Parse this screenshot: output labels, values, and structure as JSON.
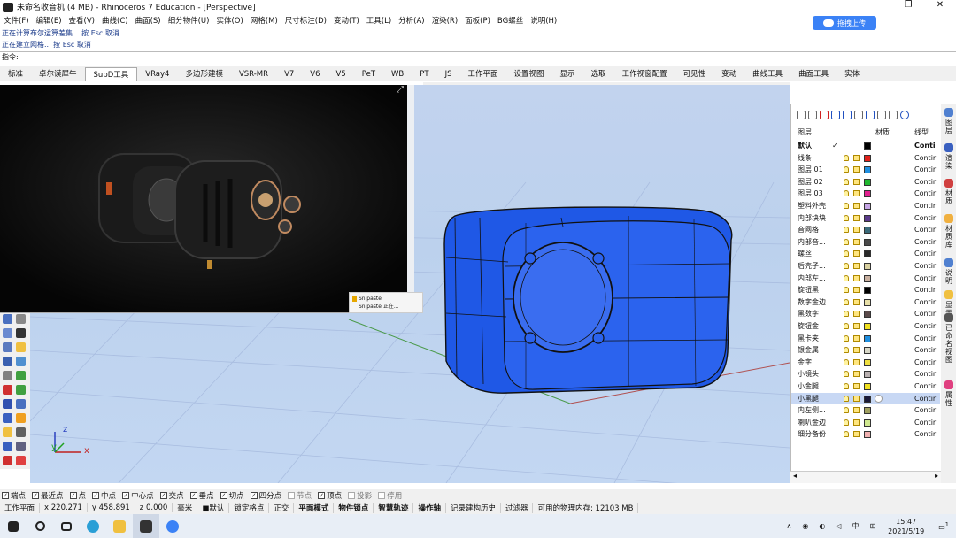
{
  "window": {
    "title": "未命名收音机 (4 MB) - Rhinoceros 7 Education - [Perspective]"
  },
  "menu": [
    "文件(F)",
    "编辑(E)",
    "查看(V)",
    "曲线(C)",
    "曲面(S)",
    "细分物件(U)",
    "实体(O)",
    "网格(M)",
    "尺寸标注(D)",
    "变动(T)",
    "工具(L)",
    "分析(A)",
    "渲染(R)",
    "面板(P)",
    "BG螺丝",
    "说明(H)"
  ],
  "upload": {
    "label": "拖拽上传"
  },
  "command_history": [
    "正在计算布尔运算差集... 按 Esc 取消",
    "正在建立网格... 按 Esc 取消"
  ],
  "command_prompt": "指令:",
  "tabs": [
    "标准",
    "卓尔谟犀牛",
    "SubD工具",
    "VRay4",
    "多边形建模",
    "VSR-MR",
    "V7",
    "V6",
    "V5",
    "PeT",
    "WB",
    "PT",
    "JS",
    "工作平面",
    "设置视图",
    "显示",
    "选取",
    "工作视窗配置",
    "可见性",
    "变动",
    "曲线工具",
    "曲面工具",
    "实体"
  ],
  "active_tab": "SubD工具",
  "snipaste": {
    "app": "Snipaste",
    "text": "Snipaste 正在..."
  },
  "layers": {
    "headers": {
      "layer": "图层",
      "material": "材质",
      "linetype": "线型"
    },
    "rows": [
      {
        "name": "默认",
        "color": "#000000",
        "linetype": "Conti",
        "current": true
      },
      {
        "name": "线条",
        "color": "#e0201a",
        "linetype": "Contir"
      },
      {
        "name": "图层 01",
        "color": "#1f8fe0",
        "linetype": "Contir"
      },
      {
        "name": "图层 02",
        "color": "#20b830",
        "linetype": "Contir"
      },
      {
        "name": "图层 03",
        "color": "#e0208f",
        "linetype": "Contir"
      },
      {
        "name": "塑料外壳",
        "color": "#c6a6e6",
        "linetype": "Contir"
      },
      {
        "name": "内部块块",
        "color": "#5a3a8a",
        "linetype": "Contir"
      },
      {
        "name": "音网格",
        "color": "#3a6a7a",
        "linetype": "Contir"
      },
      {
        "name": "内部音...",
        "color": "#4a4a4a",
        "linetype": "Contir"
      },
      {
        "name": "螺丝",
        "color": "#2a2a2a",
        "linetype": "Contir"
      },
      {
        "name": "后壳子...",
        "color": "#d8d0a0",
        "linetype": "Contir"
      },
      {
        "name": "内部左...",
        "color": "#c8b0a0",
        "linetype": "Contir"
      },
      {
        "name": "旋钮黑",
        "color": "#000000",
        "linetype": "Contir"
      },
      {
        "name": "数字金边",
        "color": "#e8e0a8",
        "linetype": "Contir"
      },
      {
        "name": "黑数字",
        "color": "#5a4a4a",
        "linetype": "Contir"
      },
      {
        "name": "旋钮金",
        "color": "#f0e020",
        "linetype": "Contir"
      },
      {
        "name": "黑卡夹",
        "color": "#1f8fe0",
        "linetype": "Contir"
      },
      {
        "name": "银金属",
        "color": "#d8d8c8",
        "linetype": "Contir"
      },
      {
        "name": "金字",
        "color": "#f0e040",
        "linetype": "Contir"
      },
      {
        "name": "小镜头",
        "color": "#b8b0b0",
        "linetype": "Contir"
      },
      {
        "name": "小金腿",
        "color": "#f0e020",
        "linetype": "Contir"
      },
      {
        "name": "小黑腿",
        "color": "#1a1a3a",
        "linetype": "Contir",
        "selected": true
      },
      {
        "name": "内左侧...",
        "color": "#a0a060",
        "linetype": "Contir"
      },
      {
        "name": "喇叭金边",
        "color": "#d0e890",
        "linetype": "Contir"
      },
      {
        "name": "细分备份",
        "color": "#f0b0b0",
        "linetype": "Contir"
      }
    ]
  },
  "right_tabs": [
    "图层",
    "渲染",
    "材质",
    "材质库",
    "说明",
    "显示",
    "已命名视图",
    "属性"
  ],
  "osnap": [
    {
      "label": "端点",
      "on": true
    },
    {
      "label": "最近点",
      "on": true
    },
    {
      "label": "点",
      "on": true
    },
    {
      "label": "中点",
      "on": true
    },
    {
      "label": "中心点",
      "on": true
    },
    {
      "label": "交点",
      "on": true
    },
    {
      "label": "垂点",
      "on": true
    },
    {
      "label": "切点",
      "on": true
    },
    {
      "label": "四分点",
      "on": true
    },
    {
      "label": "节点",
      "on": false
    },
    {
      "label": "顶点",
      "on": true
    },
    {
      "label": "投影",
      "on": false
    },
    {
      "label": "停用",
      "on": false
    }
  ],
  "status": {
    "cplane": "工作平面",
    "x": "x 220.271",
    "y": "y 458.891",
    "z": "z 0.000",
    "unit": "毫米",
    "layer": "默认",
    "toggles": [
      "锁定格点",
      "正交",
      "平面模式",
      "物件锁点",
      "智慧轨迹",
      "操作轴",
      "记录建构历史",
      "过滤器"
    ],
    "memory": "可用的物理内存: 12103 MB"
  },
  "taskbar": {
    "time": "15:47",
    "date": "2021/5/19",
    "ime": "中",
    "notifications": "1"
  },
  "axes": {
    "x": "x",
    "y": "y",
    "z": "z"
  }
}
